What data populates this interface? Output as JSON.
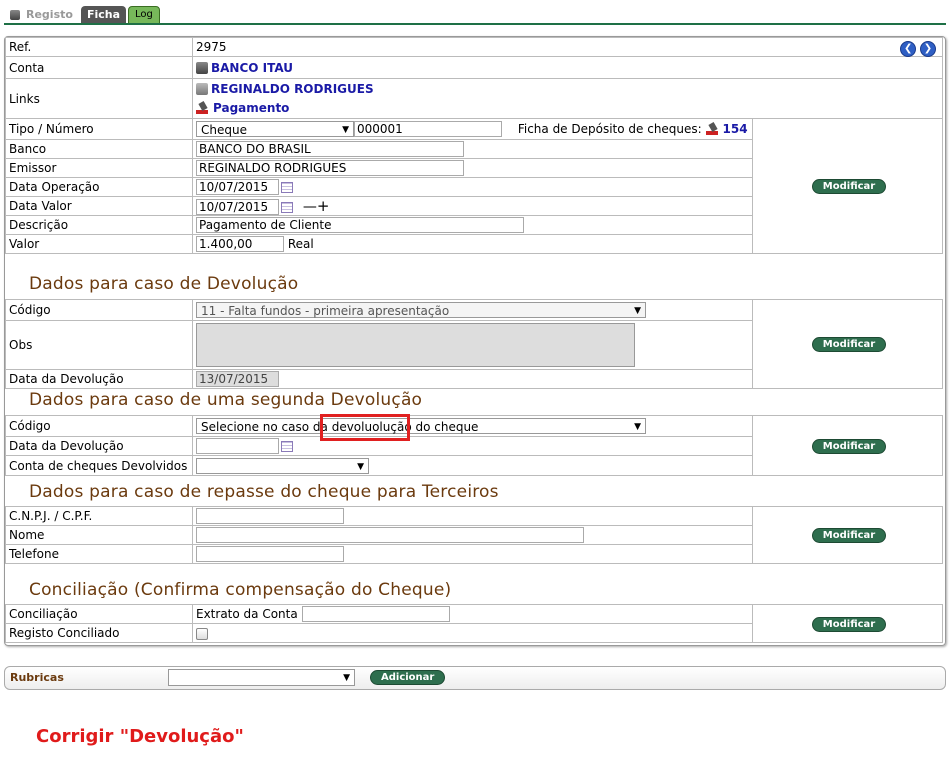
{
  "tabs": {
    "registo": "Registo",
    "ficha": "Ficha",
    "log": "Log"
  },
  "geral": {
    "ref_label": "Ref.",
    "ref_value": "2975",
    "conta_label": "Conta",
    "conta_value": "BANCO ITAU",
    "links_label": "Links",
    "link1": "REGINALDO RODRIGUES",
    "link2": "Pagamento",
    "tipo_label": "Tipo / Número",
    "tipo_value": "Cheque",
    "numero_value": "000001",
    "ficha_label": "Ficha de Depósito de cheques:",
    "ficha_value": "154",
    "banco_label": "Banco",
    "banco_value": "BANCO DO BRASIL",
    "emissor_label": "Emissor",
    "emissor_value": "REGINALDO RODRIGUES",
    "data_op_label": "Data Operação",
    "data_op_value": "10/07/2015",
    "data_valor_label": "Data Valor",
    "data_valor_value": "10/07/2015",
    "minus": "—",
    "plus": "+",
    "descricao_label": "Descrição",
    "descricao_value": "Pagamento de Cliente",
    "valor_label": "Valor",
    "valor_value": "1.400,00",
    "moeda": "Real",
    "modificar": "Modificar"
  },
  "devolucao": {
    "title": "Dados para caso de Devolução",
    "codigo_label": "Código",
    "codigo_value": "11 - Falta fundos - primeira apresentação",
    "obs_label": "Obs",
    "data_label": "Data da Devolução",
    "data_value": "13/07/2015",
    "modificar": "Modificar"
  },
  "segunda": {
    "title": "Dados para caso de uma segunda Devolução",
    "codigo_label": "Código",
    "codigo_value": "Selecione no caso da devoluolução do cheque",
    "data_label": "Data da Devolução",
    "conta_label": "Conta de cheques Devolvidos",
    "modificar": "Modificar"
  },
  "repasse": {
    "title": "Dados para caso de repasse do cheque para Terceiros",
    "cnpj_label": "C.N.P.J. / C.P.F.",
    "nome_label": "Nome",
    "telefone_label": "Telefone",
    "modificar": "Modificar"
  },
  "conciliacao": {
    "title": "Conciliação (Confirma compensação do Cheque)",
    "conc_label": "Conciliação",
    "extrato_label": "Extrato da Conta",
    "registo_label": "Registo Conciliado",
    "modificar": "Modificar"
  },
  "bottom": {
    "rubricas": "Rubricas",
    "adicionar": "Adicionar"
  },
  "annotation": "Corrigir \"Devolução\""
}
